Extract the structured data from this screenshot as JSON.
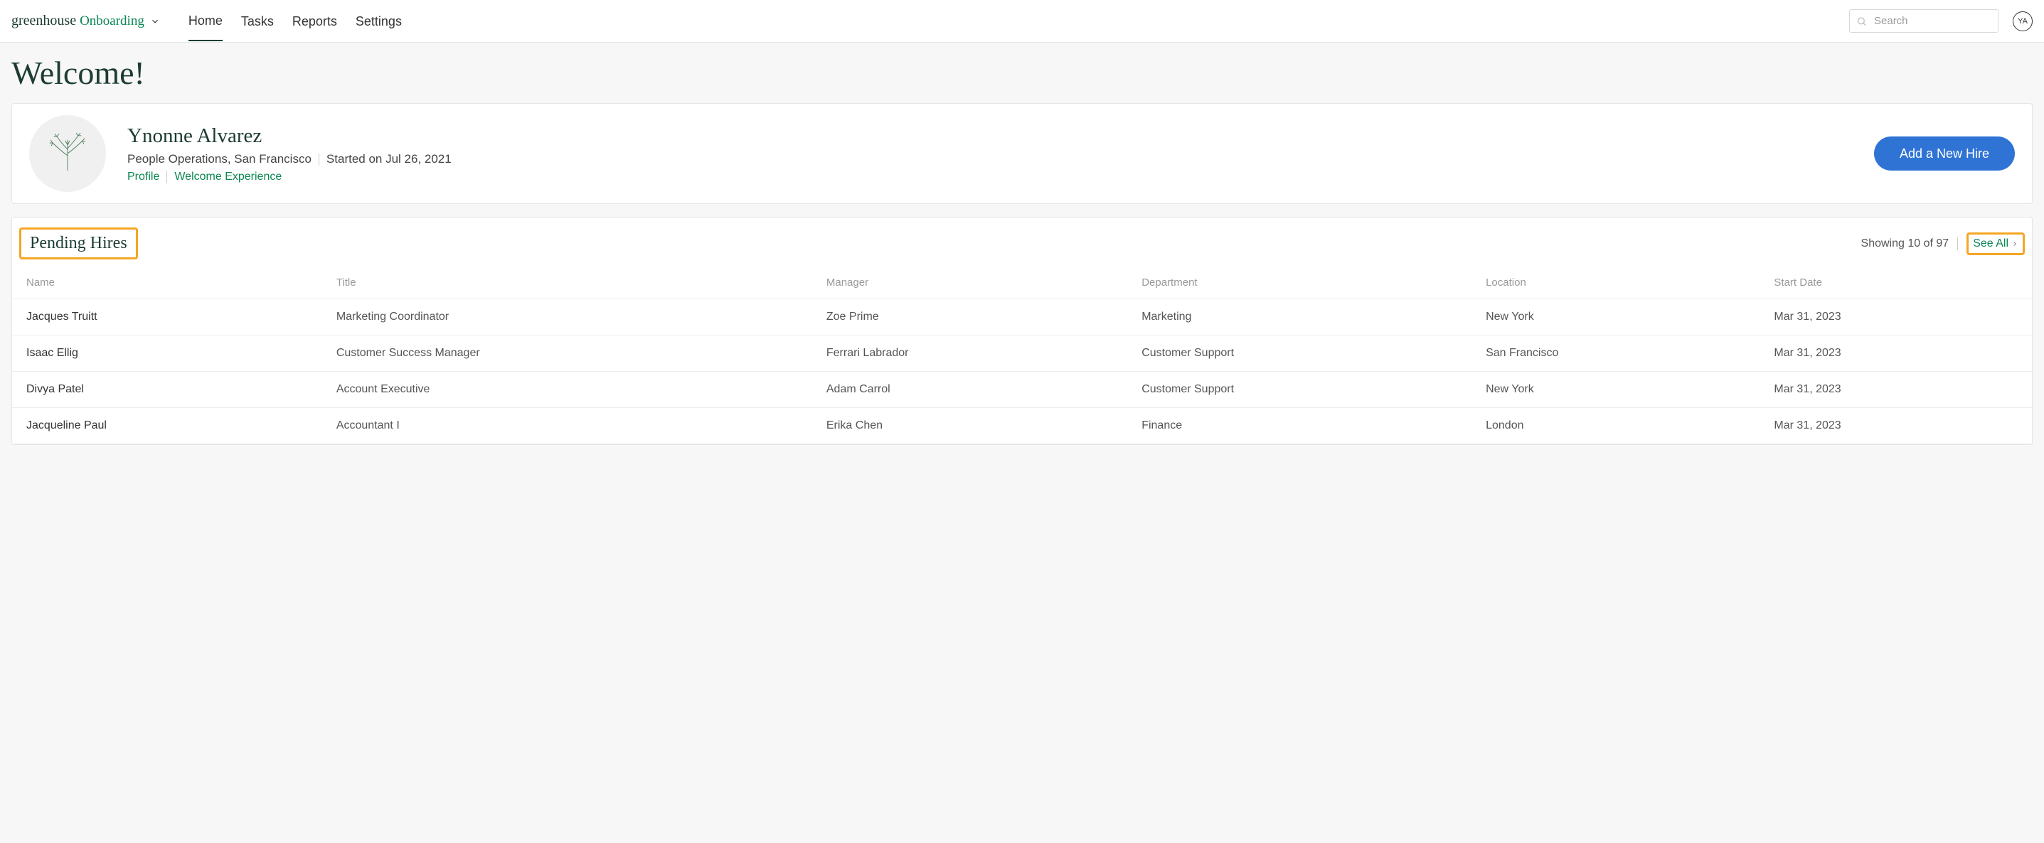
{
  "logo": {
    "part1": "greenhouse",
    "part2": "Onboarding"
  },
  "nav": {
    "home": "Home",
    "tasks": "Tasks",
    "reports": "Reports",
    "settings": "Settings"
  },
  "search": {
    "placeholder": "Search"
  },
  "user_badge": "YA",
  "page_title": "Welcome!",
  "user": {
    "name": "Ynonne Alvarez",
    "dept_loc": "People Operations, San Francisco",
    "started": "Started on Jul 26, 2021",
    "profile_link": "Profile",
    "welcome_link": "Welcome Experience"
  },
  "add_hire_label": "Add a New Hire",
  "pending": {
    "title": "Pending Hires",
    "showing": "Showing 10 of 97",
    "see_all": "See All",
    "columns": {
      "name": "Name",
      "title": "Title",
      "manager": "Manager",
      "department": "Department",
      "location": "Location",
      "start_date": "Start Date"
    },
    "rows": [
      {
        "name": "Jacques Truitt",
        "title": "Marketing Coordinator",
        "manager": "Zoe Prime",
        "department": "Marketing",
        "location": "New York",
        "start_date": "Mar 31, 2023"
      },
      {
        "name": "Isaac Ellig",
        "title": "Customer Success Manager",
        "manager": "Ferrari Labrador",
        "department": "Customer Support",
        "location": "San Francisco",
        "start_date": "Mar 31, 2023"
      },
      {
        "name": "Divya Patel",
        "title": "Account Executive",
        "manager": "Adam Carrol",
        "department": "Customer Support",
        "location": "New York",
        "start_date": "Mar 31, 2023"
      },
      {
        "name": "Jacqueline Paul",
        "title": "Accountant I",
        "manager": "Erika Chen",
        "department": "Finance",
        "location": "London",
        "start_date": "Mar 31, 2023"
      }
    ]
  }
}
